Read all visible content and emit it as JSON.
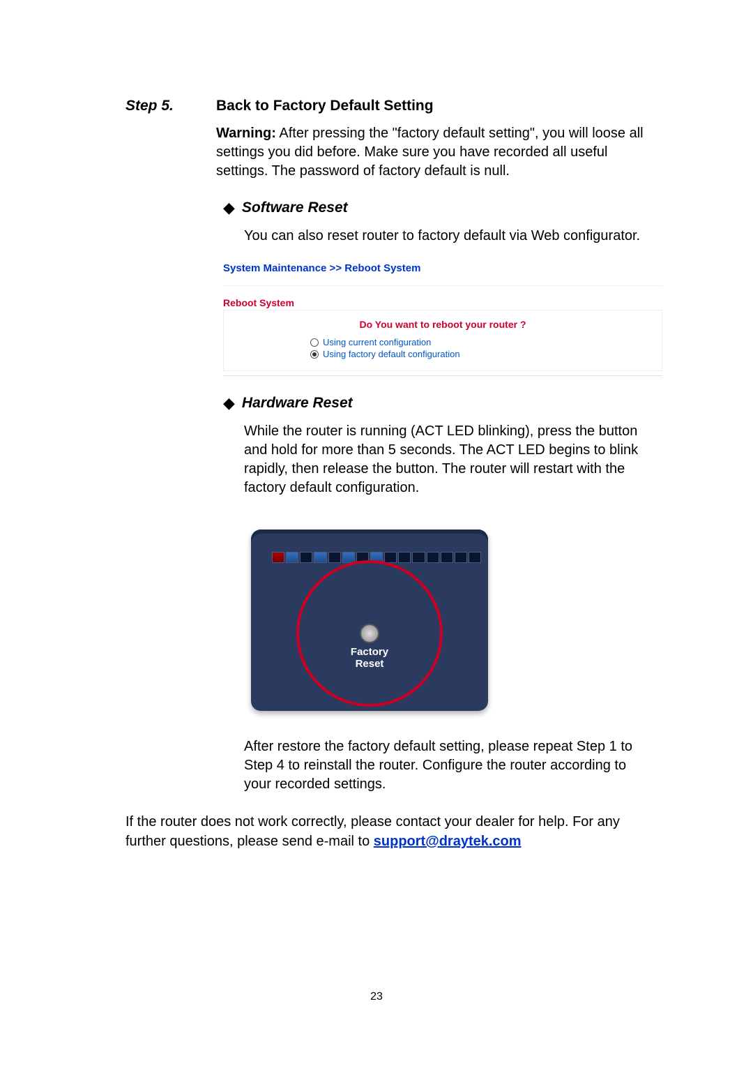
{
  "step": {
    "label": "Step 5.",
    "title": "Back to Factory Default Setting"
  },
  "warning": {
    "prefix": "Warning:",
    "body": " After pressing the \"factory default setting\", you will loose all settings you did before. Make sure you have recorded all useful settings. The password of factory default is null."
  },
  "software_reset": {
    "title": "Software Reset",
    "body": "You can also reset router to factory default via Web configurator."
  },
  "webshot": {
    "breadcrumb": "System Maintenance >> Reboot System",
    "heading": "Reboot System",
    "question": "Do You want to reboot your router ?",
    "option1": "Using current configuration",
    "option2": "Using factory default configuration"
  },
  "hardware_reset": {
    "title": "Hardware Reset",
    "body": "While the router is running (ACT LED blinking), press the button and hold for more than 5 seconds. The ACT LED begins to blink rapidly, then release the button. The router will restart with the factory default configuration."
  },
  "router": {
    "label_line1": "Factory",
    "label_line2": "Reset"
  },
  "after_restore": "After restore the factory default setting, please repeat Step 1 to Step 4 to reinstall the router. Configure the router according to your recorded settings.",
  "final": {
    "text_before": "If the router does not work correctly, please contact your dealer for help. For any further questions, please send e-mail to ",
    "link": "support@draytek.com"
  },
  "page_number": "23"
}
